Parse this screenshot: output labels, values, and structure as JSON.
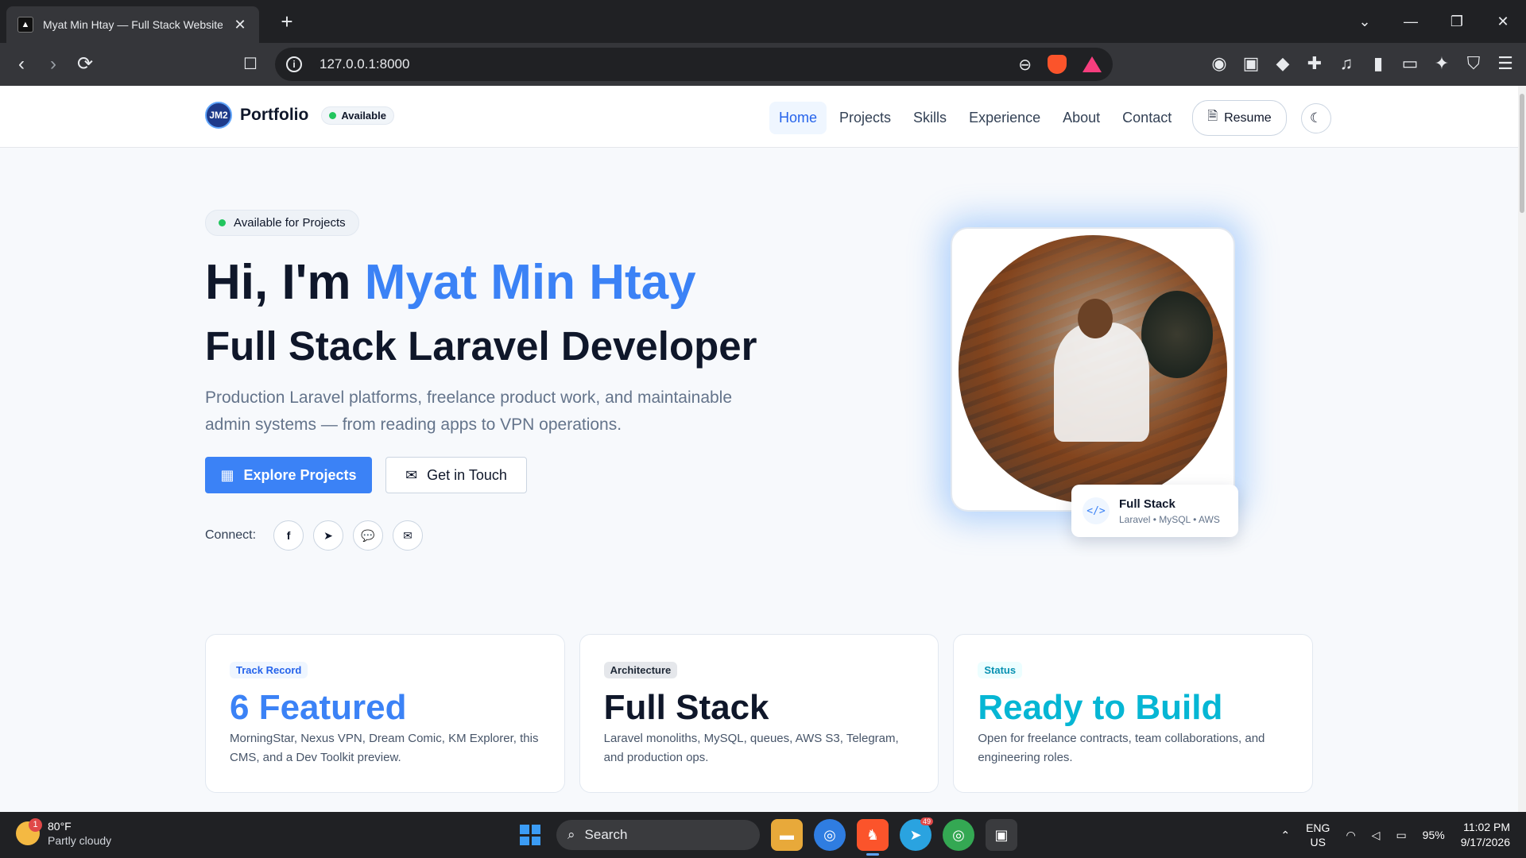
{
  "browser": {
    "tab_title": "Myat Min Htay — Full Stack Website De",
    "url": "127.0.0.1:8000",
    "new_tab": "+",
    "win_controls": [
      "⌄",
      "—",
      "❐",
      "✕"
    ]
  },
  "site": {
    "brand": "Portfolio",
    "logo_text": "JM2",
    "status_pill": "Available",
    "nav": [
      {
        "label": "Home",
        "active": true
      },
      {
        "label": "Projects"
      },
      {
        "label": "Skills"
      },
      {
        "label": "Experience"
      },
      {
        "label": "About"
      },
      {
        "label": "Contact"
      }
    ],
    "resume_label": "Resume",
    "accent": "#3b82f6"
  },
  "hero": {
    "badge": "Available for Projects",
    "greeting": "Hi, I'm",
    "name": "Myat Min Htay",
    "role": "Full Stack Laravel Developer",
    "description": "Production Laravel platforms, freelance product work, and maintainable admin systems — from reading apps to VPN operations.",
    "cta_primary": "Explore Projects",
    "cta_secondary": "Get in Touch",
    "connect_label": "Connect:",
    "socials": [
      "facebook-icon",
      "telegram-icon",
      "messenger-icon",
      "mail-icon"
    ],
    "stack_card": {
      "title": "Full Stack",
      "subtitle": "Laravel • MySQL • AWS",
      "icon": "</>"
    }
  },
  "cards": [
    {
      "tag": "Track Record",
      "headline": "6 Featured",
      "description": "MorningStar, Nexus VPN, Dream Comic, KM Explorer, this CMS, and a Dev Toolkit preview."
    },
    {
      "tag": "Architecture",
      "headline": "Full Stack",
      "description": "Laravel monoliths, MySQL, queues, AWS S3, Telegram, and production ops."
    },
    {
      "tag": "Status",
      "headline": "Ready to Build",
      "description": "Open for freelance contracts, team collaborations, and engineering roles."
    }
  ],
  "taskbar": {
    "weather_badge": "1",
    "temperature": "80°F",
    "weather": "Partly cloudy",
    "search_label": "Search",
    "telegram_badge": "49",
    "lang_top": "ENG",
    "lang_bottom": "US",
    "battery": "95%",
    "time": "11:02 PM",
    "date": "9/17/2026"
  }
}
